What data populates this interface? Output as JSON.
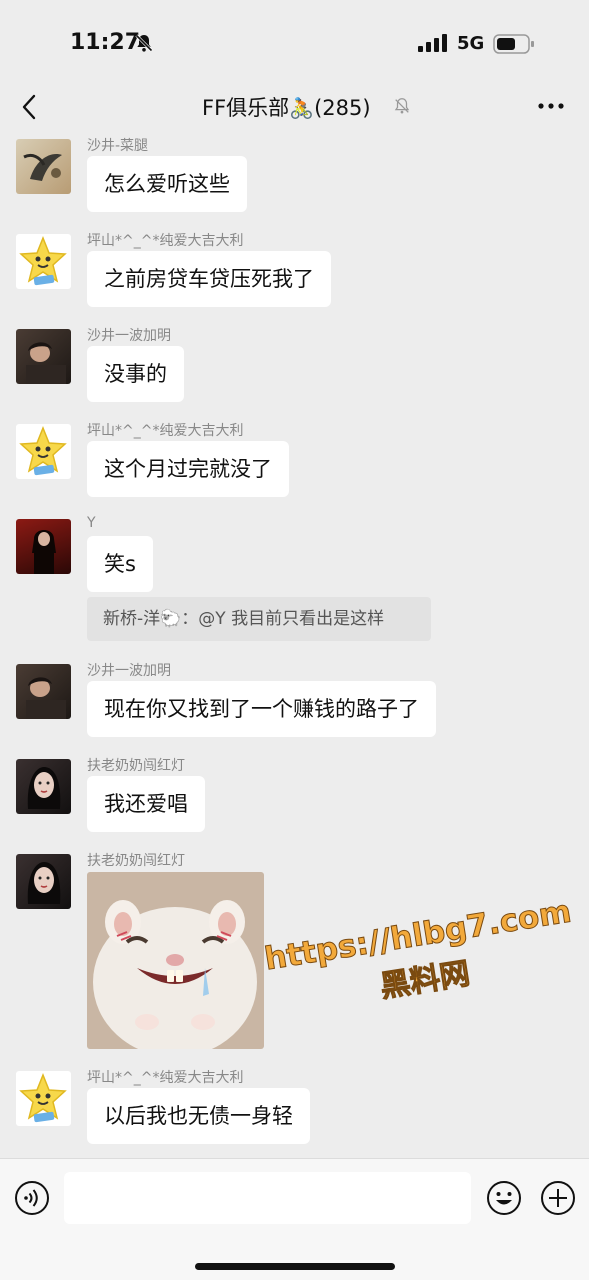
{
  "status_bar": {
    "time": "11:27",
    "network": "5G"
  },
  "header": {
    "title": "FF俱乐部",
    "title_emoji": "🚴",
    "member_count": "(285)"
  },
  "messages": [
    {
      "sender": "沙井-菜腿",
      "text": "怎么爱听这些"
    },
    {
      "sender": "坪山*^_^*纯爱大吉大利",
      "text": "之前房贷车贷压死我了"
    },
    {
      "sender": "沙井一波加明",
      "text": "没事的"
    },
    {
      "sender": "坪山*^_^*纯爱大吉大利",
      "text": "这个月过完就没了"
    },
    {
      "sender": "Y",
      "text": "笑s"
    },
    {
      "sender": "沙井一波加明",
      "text": "现在你又找到了一个赚钱的路子了"
    },
    {
      "sender": "扶老奶奶闯红灯",
      "text": "我还爱唱"
    },
    {
      "sender": "扶老奶奶闯红灯",
      "text": ""
    },
    {
      "sender": "坪山*^_^*纯爱大吉大利",
      "text": "以后我也无债一身轻"
    }
  ],
  "quote": {
    "text": "新桥-洋🐑：@Y 我目前只看出是这样"
  },
  "watermark": {
    "url": "https://hlbg7.com",
    "label": "黑料网"
  },
  "input": {
    "placeholder": ""
  },
  "icons": {
    "back": "back-arrow-icon",
    "more": "more-icon",
    "mute": "bell-off-icon",
    "voice": "voice-icon",
    "emoji": "emoji-icon",
    "plus": "plus-icon"
  },
  "colors": {
    "background": "#ededed",
    "bubble": "#ffffff",
    "sender": "#888888",
    "watermark": "#f2a93b"
  }
}
